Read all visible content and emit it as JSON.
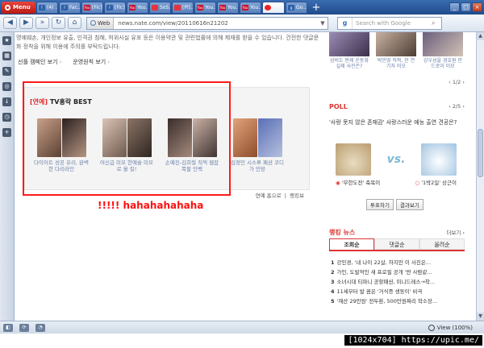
{
  "browser": {
    "menu_label": "Menu",
    "tabs": [
      {
        "label": "(4) ...",
        "fav": "f"
      },
      {
        "label": "Fac...",
        "fav": "f"
      },
      {
        "label": "[Fic]...",
        "fav": "yt"
      },
      {
        "label": "[Fic]...",
        "fav": "f"
      },
      {
        "label": "You...",
        "fav": "yt"
      },
      {
        "label": "SoS...",
        "fav": "nate"
      },
      {
        "label": "[Pl]...",
        "fav": "nate"
      },
      {
        "label": "You...",
        "fav": "yt"
      },
      {
        "label": "You...",
        "fav": "yt"
      },
      {
        "label": "You...",
        "fav": "yt"
      },
      {
        "label": "",
        "fav": "nate"
      },
      {
        "label": "Go...",
        "fav": "g"
      }
    ],
    "address": {
      "mode": "Web",
      "url": "news.nate.com/view/20110616n21202"
    },
    "search_placeholder": "Search with Google",
    "status_zoom": "View (100%)"
  },
  "page": {
    "notice": "명예훼손, 개인정보 유출, 인격권 침해, 허위사실 유포 등은 이용약관 및 관련법률에 의해 제재를 받을 수 있습니다. 건전한 댓글문화 정착을 위해 이용에 주의를 부탁드립니다.",
    "links": [
      "선플 캠페인 보기",
      "운영원칙 보기"
    ],
    "tv_best": {
      "tag": "[연예]",
      "title": "TV홍락 BEST",
      "items": [
        "다이어트 성공 유리, 완벽한 다리라인",
        "여신급 미모 한예슬 미모로 올 킬!",
        "손예진-김희철 직찍 웹잡 폭팔 인백",
        "김정민 시스루 패션 코디가 민망"
      ],
      "more_links": [
        "연예 홈으로",
        "랭킹보"
      ]
    },
    "annotation": "!!!!! hahahahahaha"
  },
  "sidebar_right": {
    "celebs": [
      "삼비도 판제 운동화 실제 사진은?",
      "박민영 직찍, 한 연기자 미모",
      "강우성을 경호원 안드로이 미모"
    ],
    "celeb_pager": "1/2",
    "poll": {
      "title": "POLL",
      "pager": "2/5",
      "question": "'사랑 못지 않은 존재감' 사랑스러운 예능 출연 견공은?",
      "options": [
        {
          "name": "'무한도전' 축복이",
          "color": "#d33"
        },
        {
          "name": "'1박2일' 상근이",
          "color": "#d33"
        }
      ],
      "vs": "vs.",
      "buttons": [
        "투표하기",
        "결과보기"
      ]
    },
    "news": {
      "title": "랭킹 뉴스",
      "more": "더보기",
      "tabs": [
        "조회순",
        "댓글순",
        "올려순"
      ],
      "active_tab": 0,
      "items": [
        "강민경, '내 나이 22살, 하지만 이 사진은...",
        "가인, 도발적인 새 프로필 공개 '딴 사람같...",
        "소녀시대 티파니 공항패션, 미니드레스→착...",
        "11세부터 발 꼼은 '거식증 생동이' 비극",
        "'재산 29만원' 전두환, 500만원짜리 학소장..."
      ]
    }
  },
  "watermark": "[1024x704] https://upic.me/"
}
